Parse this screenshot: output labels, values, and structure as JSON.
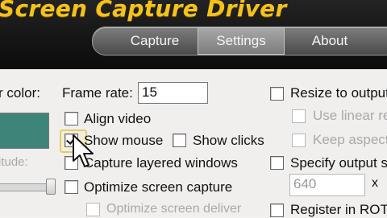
{
  "app": {
    "title": "Screen Capture Driver"
  },
  "tabs": [
    {
      "label": "Capture",
      "active": false
    },
    {
      "label": "Settings",
      "active": true
    },
    {
      "label": "About",
      "active": false
    }
  ],
  "left_column": {
    "color_label": "r color:",
    "color_value": "#3f8479",
    "altitude_label": "itude:",
    "slider_level_percent": 92
  },
  "frame_rate": {
    "label": "Frame rate:",
    "value": "15"
  },
  "options": {
    "align_video": {
      "label": "Align video",
      "checked": false
    },
    "show_mouse": {
      "label": "Show mouse",
      "checked": true
    },
    "show_clicks": {
      "label": "Show clicks",
      "checked": false
    },
    "capture_layered": {
      "label": "Capture layered windows",
      "checked": false
    },
    "optimize_capture": {
      "label": "Optimize screen capture",
      "checked": false
    },
    "optimize_deliver": {
      "label": "Optimize screen deliver",
      "checked": false,
      "disabled": true
    }
  },
  "right_column": {
    "resize_output": {
      "label": "Resize to output",
      "checked": false
    },
    "use_linear": {
      "label": "Use linear rea",
      "checked": false,
      "disabled": true
    },
    "keep_aspect": {
      "label": "Keep aspect",
      "checked": false,
      "disabled": true
    },
    "specify_output": {
      "label": "Specify output siz",
      "checked": false
    },
    "width_value": "640",
    "times_symbol": "x",
    "register_rot": {
      "label": "Register in ROT",
      "checked": false
    }
  },
  "colors": {
    "title": "#f4c21a",
    "topbar": "#141414",
    "panel": "#f0efee"
  }
}
